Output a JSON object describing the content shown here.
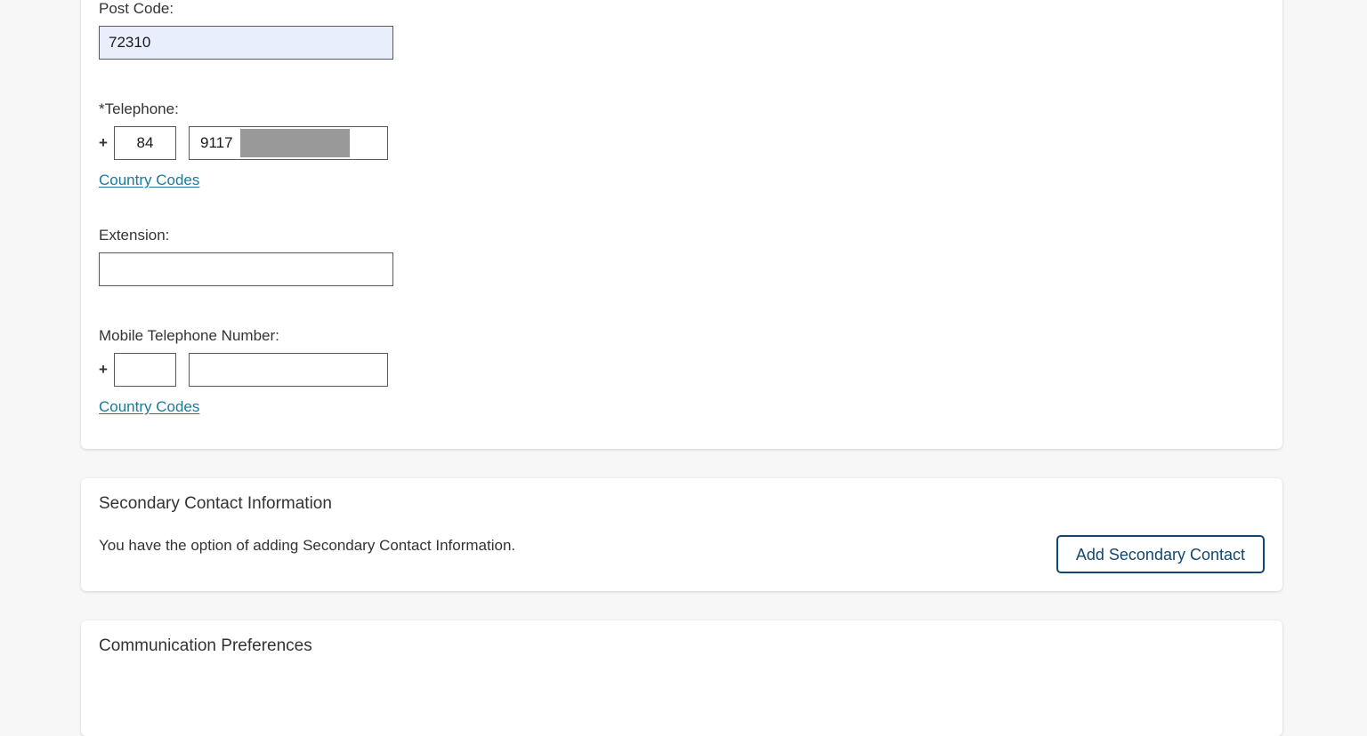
{
  "theme": {
    "page_background": "#f7f7f7",
    "card_background": "#ffffff",
    "text_color": "#333333",
    "link_color": "#1a7a9a",
    "button_accent": "#14466e",
    "input_border": "#595959",
    "autofill_background": "#e8eefb",
    "redaction_color": "#999999"
  },
  "contact_section": {
    "post_code": {
      "label": "Post Code:",
      "value": "72310",
      "placeholder": ""
    },
    "telephone": {
      "label": "*Telephone:",
      "plus": "+",
      "country_code": "84",
      "number": "9117",
      "number_placeholder": "",
      "country_code_placeholder": "",
      "redacted": true
    },
    "telephone_country_codes_link": "Country Codes",
    "extension": {
      "label": "Extension:",
      "value": "",
      "placeholder": ""
    },
    "mobile": {
      "label": "Mobile Telephone Number:",
      "plus": "+",
      "country_code": "",
      "country_code_placeholder": "",
      "number": "",
      "number_placeholder": ""
    },
    "mobile_country_codes_link": "Country Codes"
  },
  "secondary_section": {
    "title": "Secondary Contact Information",
    "description": "You have the option of adding Secondary Contact Information.",
    "add_button_label": "Add Secondary Contact"
  },
  "communication_section": {
    "title": "Communication Preferences"
  }
}
